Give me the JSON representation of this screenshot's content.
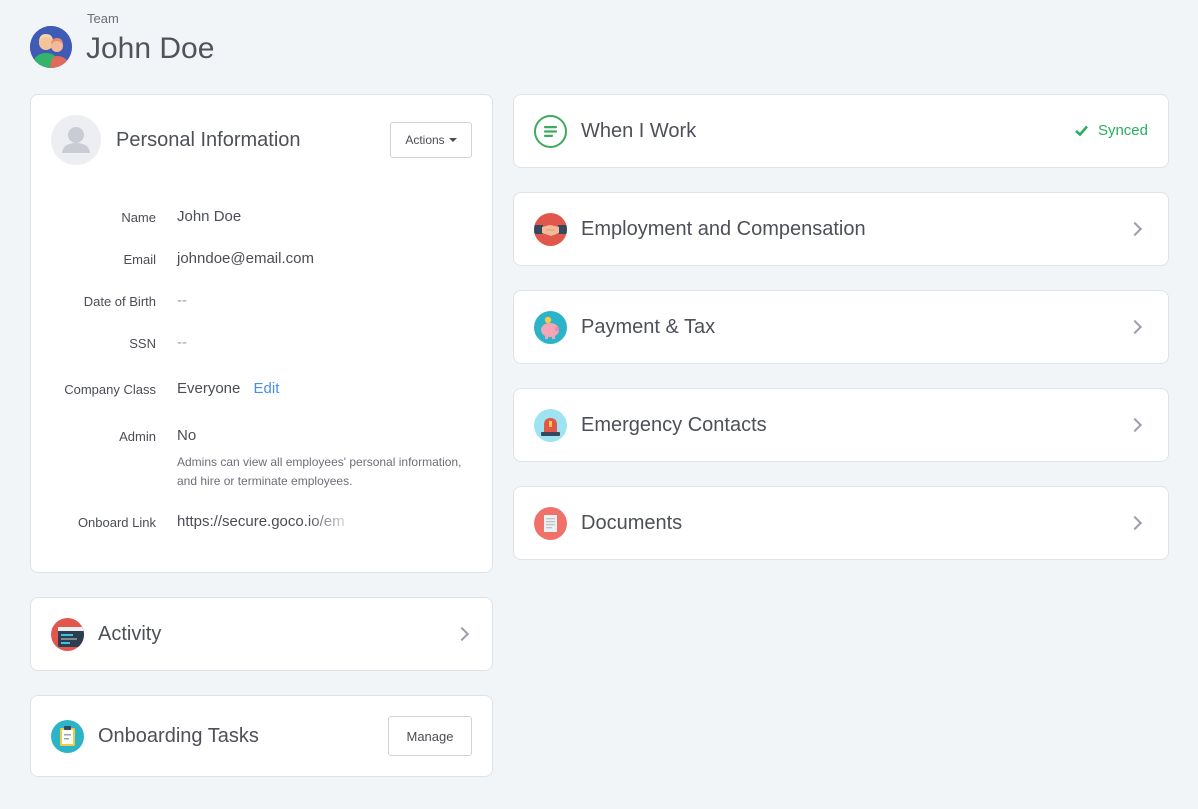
{
  "header": {
    "breadcrumb": "Team",
    "title": "John Doe",
    "avatar_icon": "team-avatar-icon"
  },
  "personal_info": {
    "title": "Personal Information",
    "actions_label": "Actions",
    "avatar_icon": "user-placeholder-icon",
    "fields": {
      "name_label": "Name",
      "name_value": "John Doe",
      "email_label": "Email",
      "email_value": "johndoe@email.com",
      "dob_label": "Date of Birth",
      "dob_value": "--",
      "ssn_label": "SSN",
      "ssn_value": "--",
      "class_label": "Company Class",
      "class_value": "Everyone",
      "class_edit": "Edit",
      "admin_label": "Admin",
      "admin_value": "No",
      "admin_note": "Admins can view all employees' personal information, and hire or terminate employees.",
      "onboard_label": "Onboard Link",
      "onboard_value": "https://secure.goco.io/em"
    }
  },
  "activity": {
    "title": "Activity",
    "icon": "activity-icon"
  },
  "onboarding": {
    "title": "Onboarding Tasks",
    "manage_label": "Manage",
    "icon": "clipboard-icon"
  },
  "when_i_work": {
    "title": "When I Work",
    "status": "Synced",
    "icon": "when-i-work-icon"
  },
  "sections": [
    {
      "title": "Employment and Compensation",
      "icon": "handshake-icon"
    },
    {
      "title": "Payment & Tax",
      "icon": "piggy-bank-icon"
    },
    {
      "title": "Emergency Contacts",
      "icon": "siren-icon"
    },
    {
      "title": "Documents",
      "icon": "document-icon"
    }
  ],
  "colors": {
    "background": "#f2f5f8",
    "link": "#4a90e2",
    "synced": "#27ae60"
  }
}
